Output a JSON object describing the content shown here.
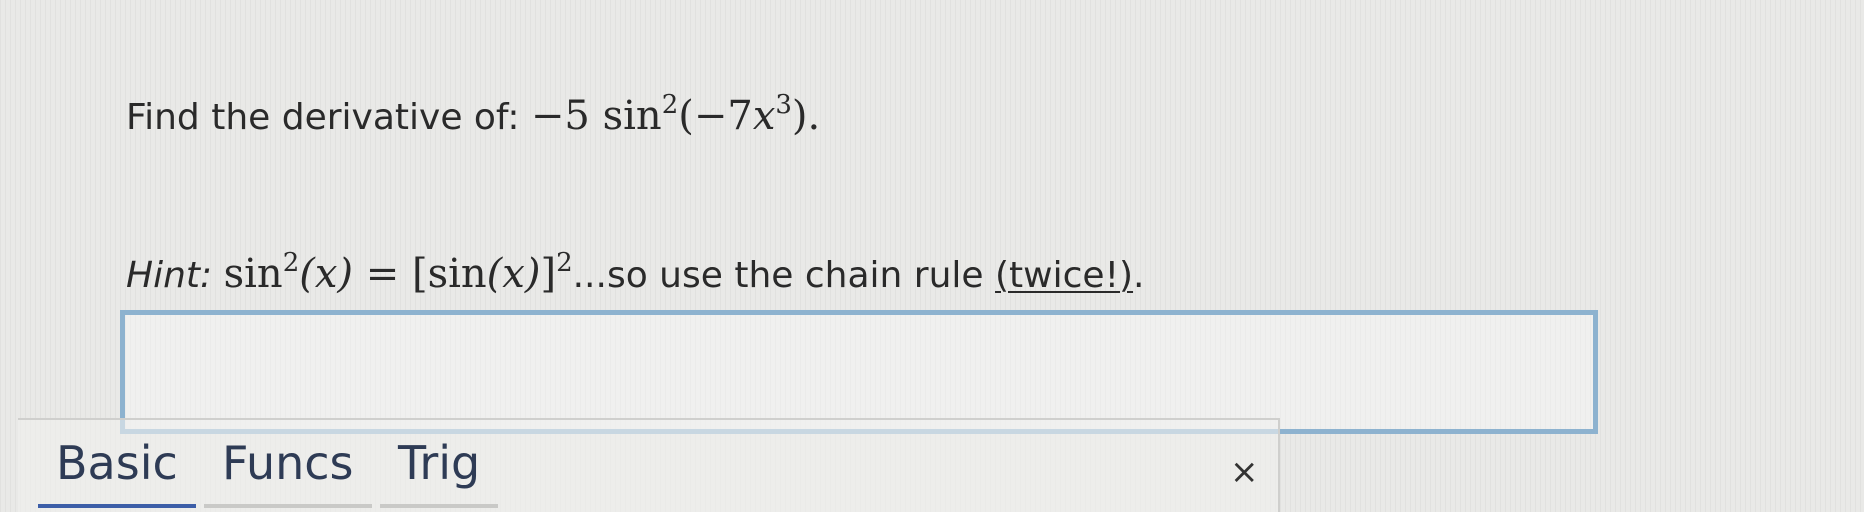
{
  "question": {
    "prompt": "Find the derivative of:",
    "expression": {
      "coef": "−5",
      "func": "sin",
      "exp": "2",
      "open": "(",
      "inner_coef": "−7",
      "var": "x",
      "inner_exp": "3",
      "close": ")",
      "end": "."
    }
  },
  "hint": {
    "label": "Hint:",
    "lhs_func": "sin",
    "lhs_exp": "2",
    "lhs_arg": "(x)",
    "eq": "=",
    "rhs_open": "[",
    "rhs_func": "sin",
    "rhs_arg": "(x)",
    "rhs_close": "]",
    "rhs_exp": "2",
    "text": "...so use the chain rule",
    "twice": "(twice!)",
    "end": "."
  },
  "answer": {
    "value": "",
    "placeholder": ""
  },
  "keypad": {
    "tabs": [
      {
        "label": "Basic",
        "active": true
      },
      {
        "label": "Funcs",
        "active": false
      },
      {
        "label": "Trig",
        "active": false
      }
    ],
    "close": "×"
  },
  "colors": {
    "input_border": "#8db2cf",
    "active_tab": "#3c5ea8",
    "tab_text": "#2e3b55"
  }
}
